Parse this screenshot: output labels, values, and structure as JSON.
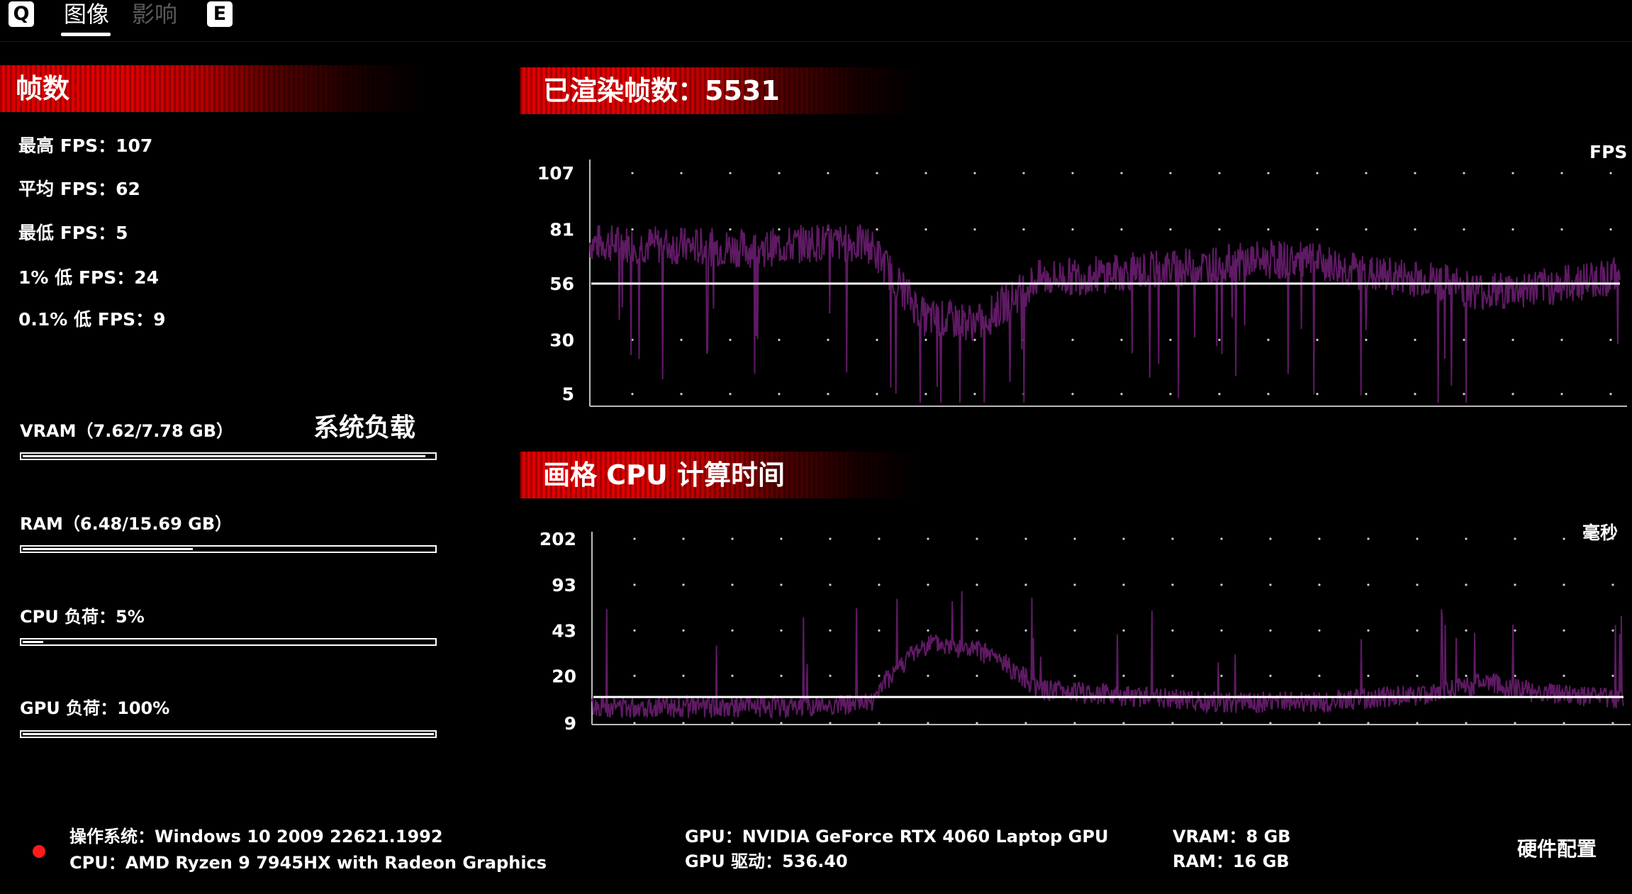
{
  "tabs": {
    "left_key": "Q",
    "right_key": "E",
    "items": [
      {
        "label": "图像",
        "active": true
      },
      {
        "label": "影响",
        "active": false
      }
    ]
  },
  "fps_section": {
    "title": "帧数",
    "max": "最高 FPS：107",
    "avg": "平均 FPS：62",
    "min": "最低 FPS：5",
    "low1": "1% 低 FPS：24",
    "low01": "0.1% 低 FPS：9"
  },
  "system_load": {
    "title": "系统负载",
    "bars": [
      {
        "label": "VRAM（7.62/7.78 GB）",
        "fraction": 0.979
      },
      {
        "label": "RAM（6.48/15.69 GB）",
        "fraction": 0.413
      },
      {
        "label": "CPU 负荷：5%",
        "fraction": 0.05
      },
      {
        "label": "GPU 负荷：100%",
        "fraction": 1.0
      }
    ]
  },
  "fps_chart": {
    "title": "已渲染帧数：5531",
    "unit": "FPS"
  },
  "cpu_chart": {
    "title": "画格 CPU 计算时间",
    "unit": "毫秒"
  },
  "colors": {
    "banner_red": "#e00000",
    "series": "#5e1a63",
    "average_line": "#ffffff",
    "dot": "#ff1a1a"
  },
  "footer": {
    "os": "操作系统：Windows 10 2009 22621.1992",
    "cpu": "CPU：AMD Ryzen 9 7945HX with Radeon Graphics",
    "gpu": "GPU：NVIDIA GeForce RTX 4060 Laptop GPU",
    "gpu_driver": "GPU 驱动：536.40",
    "vram": "VRAM：8 GB",
    "ram": "RAM：16 GB",
    "hardware_button": "硬件配置"
  },
  "chart_data": [
    {
      "type": "line",
      "title": "",
      "ylabel": "FPS",
      "yticks": [
        5,
        30,
        56,
        81,
        107
      ],
      "ylim": [
        0,
        110
      ],
      "x_range": [
        0,
        5531
      ],
      "grid": "dotted",
      "average": 56,
      "series": [
        {
          "x": [
            0,
            300,
            600,
            900,
            1200,
            1500,
            1800,
            2100,
            2400,
            2700,
            3000,
            3300,
            3600,
            3900,
            4200,
            4500,
            4800,
            5100,
            5400,
            5531
          ],
          "values": [
            75,
            74,
            73,
            72,
            75,
            74,
            40,
            38,
            58,
            60,
            62,
            64,
            67,
            66,
            60,
            58,
            52,
            54,
            58,
            60
          ]
        }
      ]
    },
    {
      "type": "line",
      "title": "",
      "ylabel": "毫秒",
      "yticks": [
        9,
        20,
        43,
        93,
        202
      ],
      "ylim": [
        9,
        202
      ],
      "scale": "log",
      "x_range": [
        0,
        5531
      ],
      "grid": "dotted",
      "average": 14,
      "series": [
        {
          "x": [
            0,
            300,
            600,
            900,
            1200,
            1500,
            1800,
            2100,
            2400,
            2700,
            3000,
            3300,
            3600,
            3900,
            4200,
            4500,
            4800,
            5100,
            5400,
            5531
          ],
          "values": [
            12,
            12,
            12,
            12,
            12,
            13,
            35,
            30,
            16,
            15,
            14,
            13,
            13,
            13,
            14,
            15,
            18,
            15,
            14,
            14
          ]
        }
      ]
    }
  ]
}
